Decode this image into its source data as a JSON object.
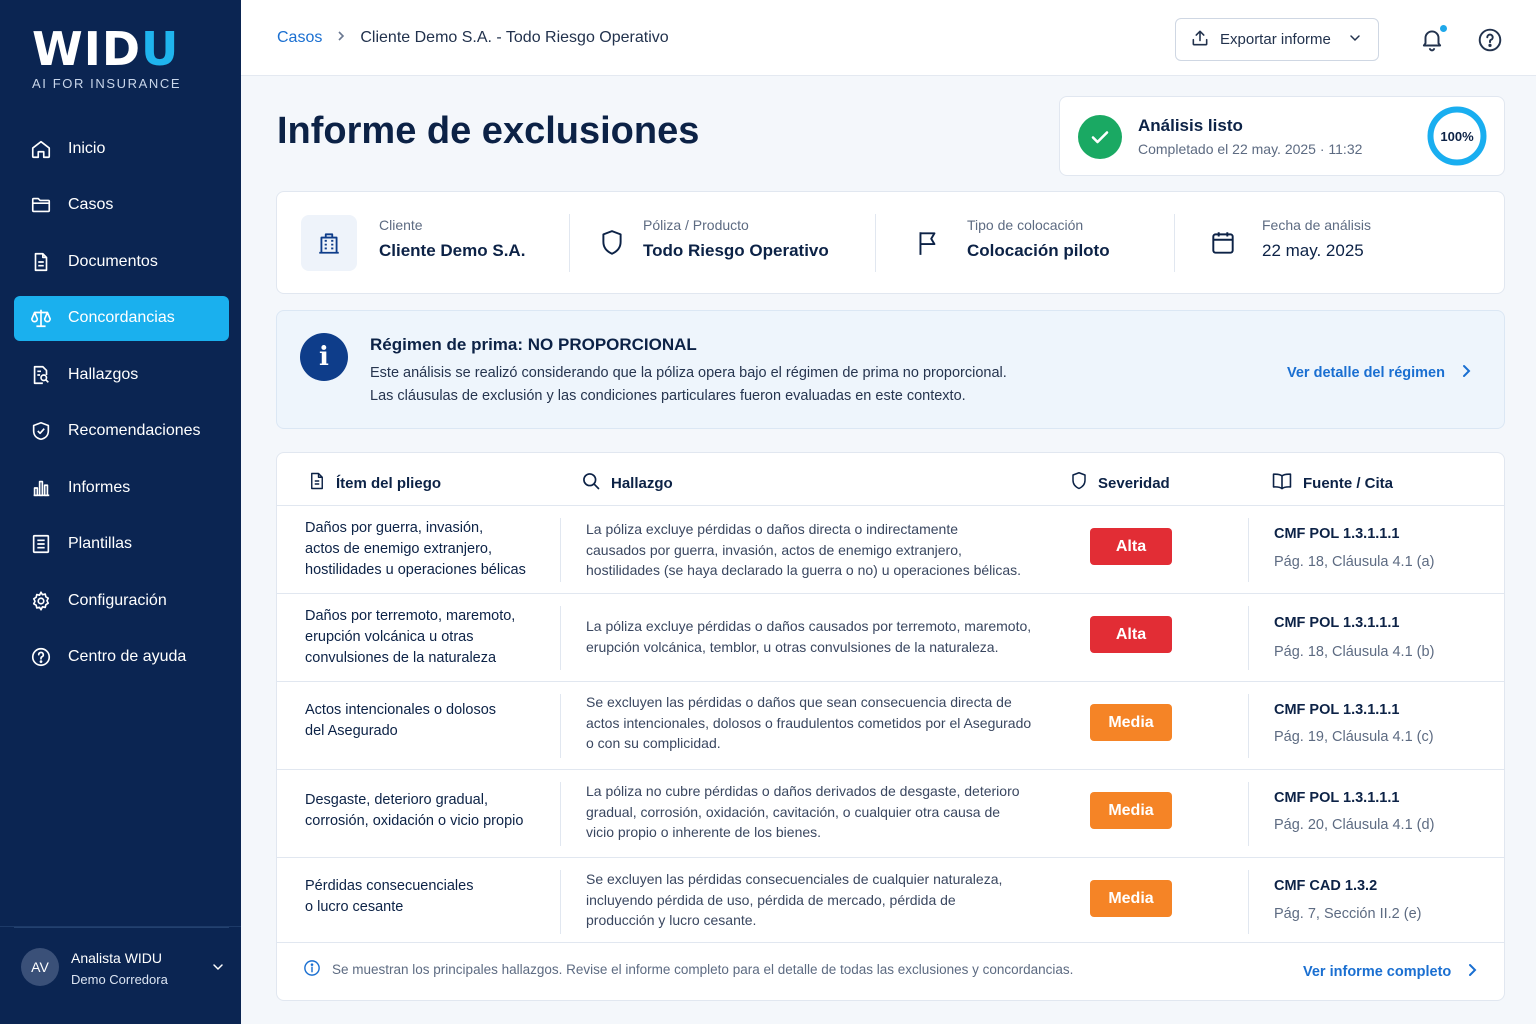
{
  "brand": {
    "logo_main": "WIDU",
    "tagline": "AI FOR INSURANCE"
  },
  "sidebar": {
    "items": [
      {
        "label": "Inicio",
        "icon": "home-icon"
      },
      {
        "label": "Casos",
        "icon": "folder-icon"
      },
      {
        "label": "Documentos",
        "icon": "document-icon"
      },
      {
        "label": "Concordancias",
        "icon": "scale-icon",
        "active": true
      },
      {
        "label": "Hallazgos",
        "icon": "search-document-icon"
      },
      {
        "label": "Recomendaciones",
        "icon": "shield-check-icon"
      },
      {
        "label": "Informes",
        "icon": "bar-chart-icon"
      },
      {
        "label": "Plantillas",
        "icon": "template-icon"
      },
      {
        "label": "Configuración",
        "icon": "gear-icon"
      },
      {
        "label": "Centro de ayuda",
        "icon": "help-circle-icon"
      }
    ],
    "user": {
      "initials": "AV",
      "name": "Analista WIDU",
      "org": "Demo Corredora"
    }
  },
  "topbar": {
    "breadcrumb": {
      "root": "Casos",
      "current": "Cliente Demo S.A. - Todo Riesgo Operativo"
    },
    "export_label": "Exportar informe"
  },
  "page": {
    "title": "Informe de exclusiones"
  },
  "status": {
    "title": "Análisis listo",
    "subtitle": "Completado el 22 may. 2025 · 11:32",
    "progress_label": "100%",
    "progress": 1.0
  },
  "summary": {
    "client_label": "Cliente",
    "client_value": "Cliente Demo S.A.",
    "policy_label": "Póliza / Producto",
    "policy_value": "Todo Riesgo Operativo",
    "placement_label": "Tipo de colocación",
    "placement_value": "Colocación piloto",
    "date_label": "Fecha de análisis",
    "date_value": "22 may. 2025"
  },
  "regime": {
    "title": "Régimen de prima: NO PROPORCIONAL",
    "line1": "Este análisis se realizó considerando que la póliza opera bajo el régimen de prima no proporcional.",
    "line2": "Las cláusulas de exclusión y las condiciones particulares fueron evaluadas en este contexto.",
    "link": "Ver detalle del régimen"
  },
  "table": {
    "headers": {
      "item": "Ítem del pliego",
      "finding": "Hallazgo",
      "severity": "Severidad",
      "source": "Fuente / Cita"
    },
    "rows": [
      {
        "item": [
          "Daños por guerra, invasión,",
          "actos de enemigo extranjero,",
          "hostilidades u operaciones bélicas"
        ],
        "finding": [
          "La póliza excluye pérdidas o daños directa o indirectamente",
          "causados por guerra, invasión, actos de enemigo extranjero,",
          "hostilidades (se haya declarado la guerra o no) u operaciones bélicas."
        ],
        "severity": "Alta",
        "severity_level": "high",
        "source_code": "CMF POL 1.3.1.1.1",
        "source_ref": "Pág. 18, Cláusula 4.1 (a)"
      },
      {
        "item": [
          "Daños por terremoto, maremoto,",
          "erupción volcánica u otras",
          "convulsiones de la naturaleza"
        ],
        "finding": [
          "La póliza excluye pérdidas o daños causados por terremoto, maremoto,",
          "erupción volcánica, temblor, u otras convulsiones de la naturaleza."
        ],
        "severity": "Alta",
        "severity_level": "high",
        "source_code": "CMF POL 1.3.1.1.1",
        "source_ref": "Pág. 18, Cláusula 4.1 (b)"
      },
      {
        "item": [
          "Actos intencionales o dolosos",
          "del Asegurado"
        ],
        "finding": [
          "Se excluyen las pérdidas o daños que sean consecuencia directa de",
          "actos intencionales, dolosos o fraudulentos cometidos por el Asegurado",
          "o con su complicidad."
        ],
        "severity": "Media",
        "severity_level": "medium",
        "source_code": "CMF POL 1.3.1.1.1",
        "source_ref": "Pág. 19, Cláusula 4.1 (c)"
      },
      {
        "item": [
          "Desgaste, deterioro gradual,",
          "corrosión, oxidación o vicio propio"
        ],
        "finding": [
          "La póliza no cubre pérdidas o daños derivados de desgaste, deterioro",
          "gradual, corrosión, oxidación, cavitación, o cualquier otra causa de",
          "vicio propio o inherente de los bienes."
        ],
        "severity": "Media",
        "severity_level": "medium",
        "source_code": "CMF POL 1.3.1.1.1",
        "source_ref": "Pág. 20, Cláusula 4.1 (d)"
      },
      {
        "item": [
          "Pérdidas consecuenciales",
          "o lucro cesante"
        ],
        "finding": [
          "Se excluyen las pérdidas consecuenciales de cualquier naturaleza,",
          "incluyendo pérdida de uso, pérdida de mercado, pérdida de",
          "producción y lucro cesante."
        ],
        "severity": "Media",
        "severity_level": "medium",
        "source_code": "CMF CAD 1.3.2",
        "source_ref": "Pág. 7, Sección II.2 (e)"
      }
    ],
    "footer_note": "Se muestran los principales hallazgos. Revise el informe completo para el detalle de todas las exclusiones y concordancias.",
    "footer_link": "Ver informe completo"
  },
  "colors": {
    "sidebar": "#0b2552",
    "accent": "#1ab0ee",
    "link": "#1a6fd1",
    "high": "#e22d35",
    "medium": "#f58426",
    "success": "#1aa963"
  }
}
